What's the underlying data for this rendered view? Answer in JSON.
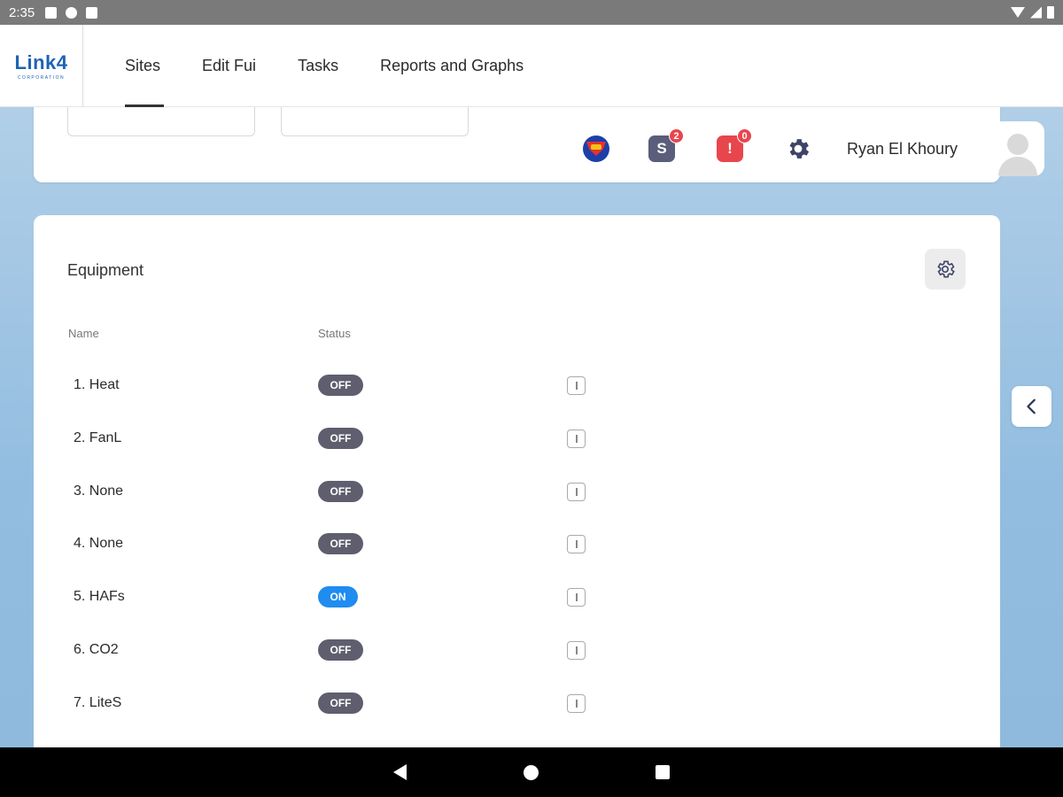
{
  "status_bar": {
    "time": "2:35"
  },
  "app": {
    "logo_text": "Link4",
    "logo_sub": "CORPORATION"
  },
  "nav": {
    "tabs": [
      {
        "label": "Sites",
        "active": true
      },
      {
        "label": "Edit Fui",
        "active": false
      },
      {
        "label": "Tasks",
        "active": false
      },
      {
        "label": "Reports and Graphs",
        "active": false
      }
    ]
  },
  "header": {
    "s_icon_letter": "S",
    "s_badge_count": "2",
    "alert_icon_letter": "!",
    "alert_badge_count": "0",
    "user_name": "Ryan El Khoury"
  },
  "equipment": {
    "title": "Equipment",
    "col_name": "Name",
    "col_status": "Status",
    "rows": [
      {
        "name": "1. Heat",
        "status": "OFF"
      },
      {
        "name": "2. FanL",
        "status": "OFF"
      },
      {
        "name": "3. None",
        "status": "OFF"
      },
      {
        "name": "4. None",
        "status": "OFF"
      },
      {
        "name": "5. HAFs",
        "status": "ON"
      },
      {
        "name": "6. CO2",
        "status": "OFF"
      },
      {
        "name": "7. LiteS",
        "status": "OFF"
      }
    ]
  },
  "colors": {
    "accent_on": "#1f8cf0",
    "toggle_off": "#5e5e6e",
    "alert": "#e8464d",
    "brand": "#1e63b5"
  },
  "icons": {
    "superman": "superman-icon",
    "settings": "gear-icon",
    "info": "info-icon",
    "side_toggle": "chevron-left-icon"
  }
}
